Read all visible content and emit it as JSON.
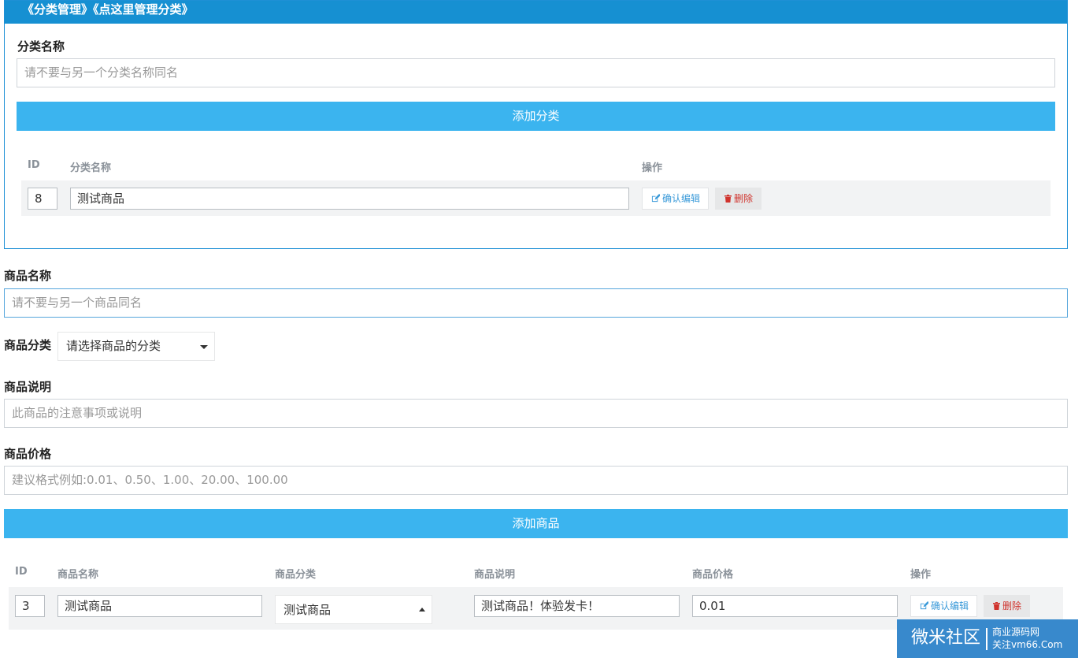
{
  "category_panel": {
    "header": "《分类管理》《点这里管理分类》",
    "name_label": "分类名称",
    "name_placeholder": "请不要与另一个分类名称同名",
    "add_button": "添加分类",
    "table": {
      "headers": [
        "ID",
        "分类名称",
        "操作"
      ],
      "rows": [
        {
          "id": "8",
          "name": "测试商品",
          "edit_label": "确认编辑",
          "delete_label": "删除"
        }
      ]
    }
  },
  "product_form": {
    "name_label": "商品名称",
    "name_placeholder": "请不要与另一个商品同名",
    "category_label": "商品分类",
    "category_select": "请选择商品的分类",
    "desc_label": "商品说明",
    "desc_placeholder": "此商品的注意事项或说明",
    "price_label": "商品价格",
    "price_placeholder": "建议格式例如:0.01、0.50、1.00、20.00、100.00",
    "add_button": "添加商品"
  },
  "product_table": {
    "headers": [
      "ID",
      "商品名称",
      "商品分类",
      "商品说明",
      "商品价格",
      "操作"
    ],
    "rows": [
      {
        "id": "3",
        "name": "测试商品",
        "category": "测试商品",
        "desc": "测试商品！体验发卡！",
        "price": "0.01",
        "edit_label": "确认编辑",
        "delete_label": "删除"
      }
    ]
  },
  "watermark": {
    "brand": "微米社区",
    "line1": "商业源码网",
    "line2": "关注vm66.Com"
  },
  "colors": {
    "panel_header": "#1690d2",
    "primary_button": "#3bb4ef",
    "delete_text": "#d0332d",
    "edit_text": "#3a9ad9"
  }
}
